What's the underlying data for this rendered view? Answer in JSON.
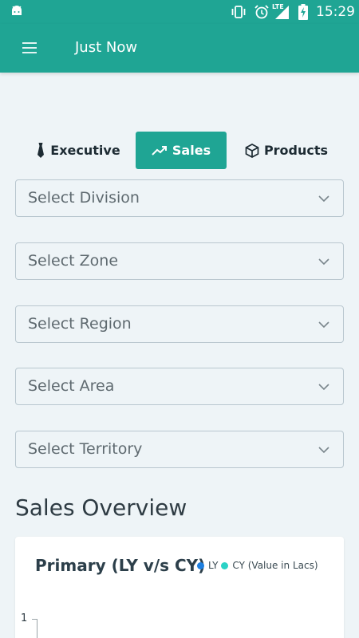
{
  "status_bar": {
    "time": "15:29",
    "network": "LTE",
    "icons": [
      "android-icon",
      "vibrate-icon",
      "alarm-icon",
      "signal-icon",
      "battery-charging-icon"
    ]
  },
  "app_bar": {
    "title": "Just Now",
    "menu_icon": "hamburger-menu-icon",
    "color": "#1fa594"
  },
  "tabs": [
    {
      "label": "Executive",
      "icon": "tie-icon",
      "active": false
    },
    {
      "label": "Sales",
      "icon": "trending-up-icon",
      "active": true
    },
    {
      "label": "Products",
      "icon": "cube-icon",
      "active": false
    }
  ],
  "filters": [
    {
      "placeholder": "Select Division"
    },
    {
      "placeholder": "Select Zone"
    },
    {
      "placeholder": "Select Region"
    },
    {
      "placeholder": "Select Area"
    },
    {
      "placeholder": "Select Territory"
    }
  ],
  "section_title": "Sales Overview",
  "chart_card": {
    "title": "Primary (LY v/s CY)",
    "legend": [
      {
        "label": "LY",
        "color": "#1e7fe0"
      },
      {
        "label": "CY (Value in Lacs)",
        "color": "#2bd2c6"
      }
    ],
    "y_tick": "1"
  },
  "chart_data": {
    "type": "line",
    "title": "Primary (LY v/s CY)",
    "series": [
      {
        "name": "LY",
        "values": []
      },
      {
        "name": "CY (Value in Lacs)",
        "values": []
      }
    ],
    "y_ticks": [
      "1"
    ]
  }
}
